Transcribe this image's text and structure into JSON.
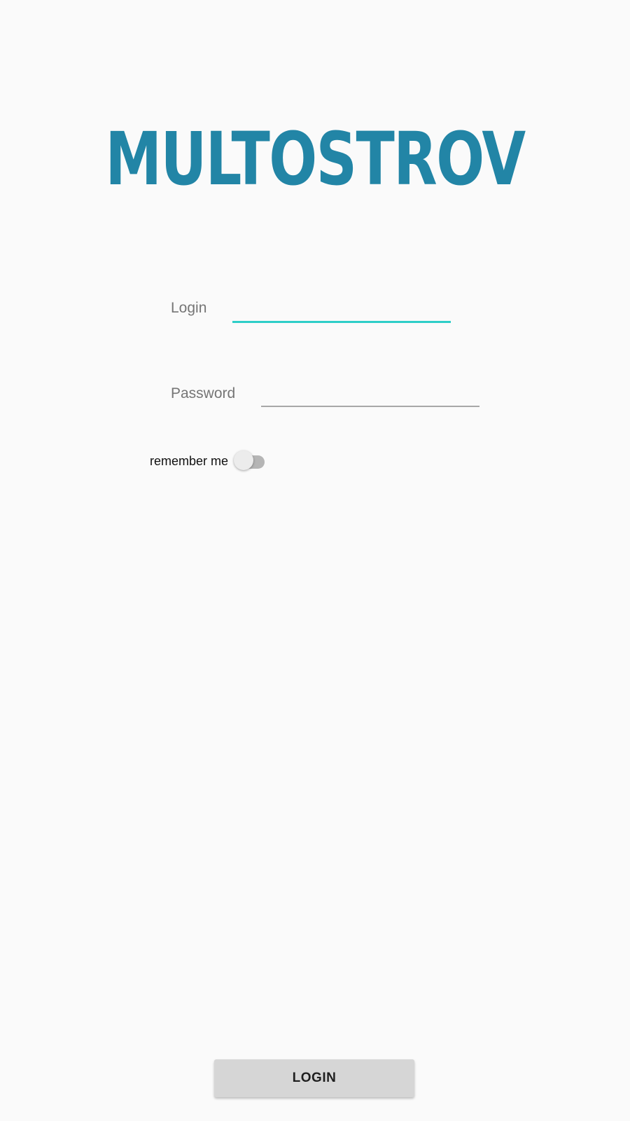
{
  "app": {
    "logo_text": "MULTOSTROV",
    "brand_color": "#2285a6"
  },
  "form": {
    "login_label": "Login",
    "login_value": "",
    "password_label": "Password",
    "password_value": "",
    "remember_label": "remember me",
    "remember_checked": false,
    "focus_color": "#2ecec8"
  },
  "actions": {
    "login_button_label": "LOGIN"
  }
}
